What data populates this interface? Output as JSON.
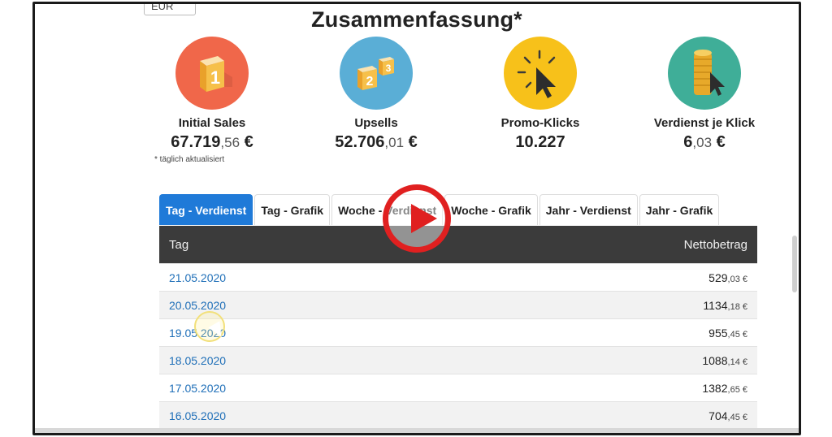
{
  "header": {
    "currency": "EUR",
    "title": "Zusammenfassung*"
  },
  "stats": [
    {
      "label": "Initial Sales",
      "value_main": "67.719",
      "value_cents": ",56",
      "currency": " €",
      "icon": "cube-1-icon",
      "color": "#f0674a"
    },
    {
      "label": "Upsells",
      "value_main": "52.706",
      "value_cents": ",01",
      "currency": " €",
      "icon": "cubes-23-icon",
      "color": "#5aaed6"
    },
    {
      "label": "Promo-Klicks",
      "value_main": "10.227",
      "value_cents": "",
      "currency": "",
      "icon": "cursor-click-icon",
      "color": "#f7c11a"
    },
    {
      "label": "Verdienst je Klick",
      "value_main": "6",
      "value_cents": ",03",
      "currency": " €",
      "icon": "coin-stack-icon",
      "color": "#3fae98"
    }
  ],
  "footnote": "* täglich aktualisiert",
  "tabs": [
    "Tag - Verdienst",
    "Tag - Grafik",
    "Woche - Verdienst",
    "Woche - Grafik",
    "Jahr - Verdienst",
    "Jahr - Grafik"
  ],
  "table": {
    "headers": [
      "Tag",
      "Nettobetrag"
    ],
    "rows": [
      {
        "date": "21.05.2020",
        "amount": "529",
        "cents": ",03",
        "cur": " €"
      },
      {
        "date": "20.05.2020",
        "amount": "1134",
        "cents": ",18",
        "cur": " €"
      },
      {
        "date": "19.05.2020",
        "amount": "955",
        "cents": ",45",
        "cur": " €"
      },
      {
        "date": "18.05.2020",
        "amount": "1088",
        "cents": ",14",
        "cur": " €"
      },
      {
        "date": "17.05.2020",
        "amount": "1382",
        "cents": ",65",
        "cur": " €"
      },
      {
        "date": "16.05.2020",
        "amount": "704",
        "cents": ",45",
        "cur": " €"
      }
    ]
  },
  "overlay": {
    "play_icon": "play-button-icon"
  }
}
